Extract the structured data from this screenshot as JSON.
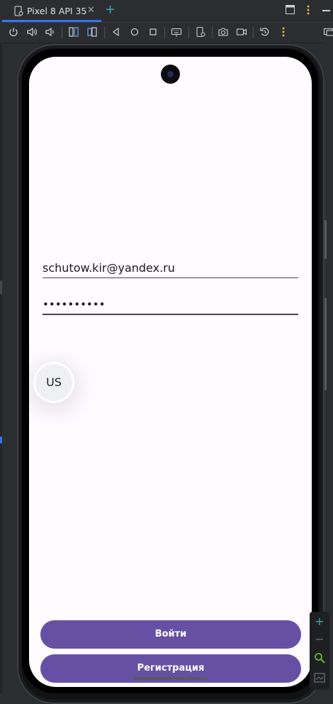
{
  "ide": {
    "tab_label": "Pixel 8 API 35",
    "tab_close": "✕",
    "tab_add": "+",
    "toolbar_icons": [
      "power-icon",
      "volume-up-icon",
      "volume-down-icon",
      "rotate-left-icon",
      "rotate-right-icon",
      "back-icon",
      "home-icon",
      "overview-icon",
      "keyboard-icon",
      "device-settings-icon",
      "camera-icon",
      "video-icon",
      "snapshot-icon",
      "more-icon",
      "display-icon"
    ],
    "accent_color": "#3574f0"
  },
  "app": {
    "email_value": "schutow.kir@yandex.ru",
    "password_value": "••••••••••",
    "fab_label": "US",
    "login_label": "Войти",
    "register_label": "Регистрация",
    "primary_color": "#6750a4"
  },
  "zoom": {
    "zoom_in": "+",
    "zoom_out": "−"
  }
}
